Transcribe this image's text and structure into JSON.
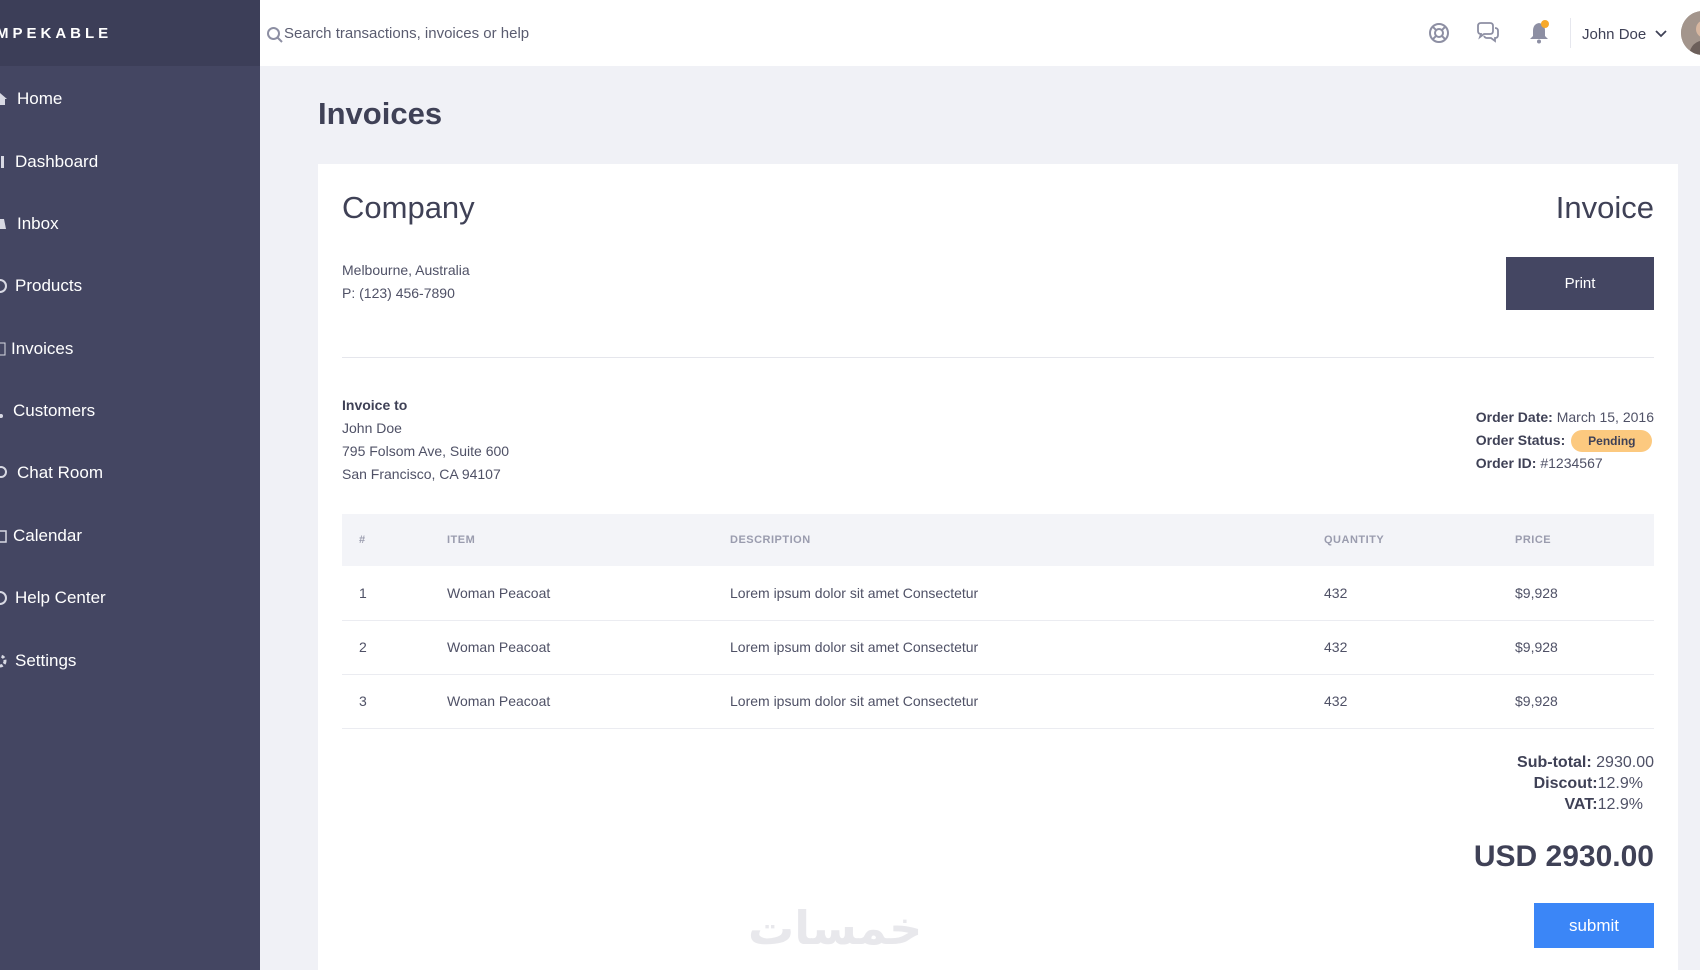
{
  "brand": {
    "name": "MPEKABLE"
  },
  "sidebar": {
    "items": [
      {
        "label": "Home",
        "icon": "home-icon"
      },
      {
        "label": "Dashboard",
        "icon": "dashboard-icon"
      },
      {
        "label": "Inbox",
        "icon": "inbox-icon"
      },
      {
        "label": "Products",
        "icon": "products-icon"
      },
      {
        "label": "Invoices",
        "icon": "invoices-icon"
      },
      {
        "label": "Customers",
        "icon": "customers-icon"
      },
      {
        "label": "Chat Room",
        "icon": "chat-icon"
      },
      {
        "label": "Calendar",
        "icon": "calendar-icon"
      },
      {
        "label": "Help Center",
        "icon": "help-icon"
      },
      {
        "label": "Settings",
        "icon": "gear-icon"
      }
    ]
  },
  "topbar": {
    "search_placeholder": "Search transactions, invoices or help",
    "user_name": "John Doe",
    "icons": [
      "support-icon",
      "chat-bubbles-icon",
      "bell-icon",
      "chevron-down-icon"
    ]
  },
  "page": {
    "title": "Invoices"
  },
  "invoice": {
    "company_name": "Company",
    "heading": "Invoice",
    "company_address": "Melbourne, Australia",
    "company_phone": "P: (123) 456-7890",
    "print_label": "Print",
    "bill_to": {
      "heading": "Invoice to",
      "name": "John Doe",
      "street": "795 Folsom Ave, Suite 600",
      "city": "San Francisco, CA 94107"
    },
    "order": {
      "date_label": "Order Date:",
      "date": "March 15, 2016",
      "status_label": "Order Status:",
      "status": "Pending",
      "id_label": "Order ID:",
      "id": "#1234567"
    },
    "table": {
      "headers": [
        "#",
        "ITEM",
        "DESCRIPTION",
        "QUANTITY",
        "PRICE"
      ],
      "rows": [
        {
          "num": "1",
          "item": "Woman Peacoat",
          "description": "Lorem ipsum dolor sit amet Consectetur",
          "quantity": "432",
          "price": "$9,928"
        },
        {
          "num": "2",
          "item": "Woman Peacoat",
          "description": "Lorem ipsum dolor sit amet Consectetur",
          "quantity": "432",
          "price": "$9,928"
        },
        {
          "num": "3",
          "item": "Woman Peacoat",
          "description": "Lorem ipsum dolor sit amet Consectetur",
          "quantity": "432",
          "price": "$9,928"
        }
      ]
    },
    "totals": {
      "subtotal_label": "Sub-total:",
      "subtotal": "2930.00",
      "discount_label": "Discout:",
      "discount": "12.9%",
      "vat_label": "VAT:",
      "vat": "12.9%",
      "grand_total": "USD 2930.00"
    },
    "submit_label": "submit"
  },
  "watermark": {
    "text": "خمسات"
  },
  "colors": {
    "sidebar": "#444662",
    "brand_bar": "#3c3e58",
    "page_bg": "#f0f1f6",
    "primary_button": "#444662",
    "submit_button": "#3b86f7",
    "status_badge": "#fcc97f",
    "notification_dot": "#f7a92b"
  }
}
